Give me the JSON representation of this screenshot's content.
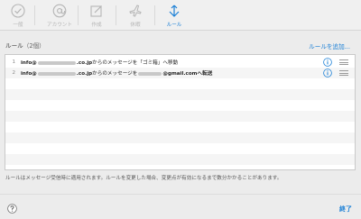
{
  "toolbar": {
    "items": [
      {
        "label": "一般",
        "icon": "check-circle-icon"
      },
      {
        "label": "アカウント",
        "icon": "at-icon"
      },
      {
        "label": "作成",
        "icon": "compose-icon"
      },
      {
        "label": "休暇",
        "icon": "airplane-icon"
      },
      {
        "label": "ルール",
        "icon": "rules-icon"
      }
    ],
    "active": "ルール"
  },
  "rules": {
    "title": "ルール",
    "count": "（2個）",
    "add_link": "ルールを追加...",
    "items": [
      {
        "num": "1",
        "prefix": "info@",
        "domain": ".co.jp",
        "text": "からのメッセージを「ゴミ箱」へ移動"
      },
      {
        "num": "2",
        "prefix": "info@",
        "domain": ".co.jp",
        "text": "からのメッセージを",
        "suffix": "@gmail.comへ転送"
      }
    ]
  },
  "note": "ルールはメッセージ受信時に適用されます。ルールを変更した場合、変更点が有効になるまで数分かかることがあります。",
  "footer": {
    "done_label": "終了"
  },
  "colors": {
    "accent": "#1a7fd6",
    "disabled": "#b5b5b5"
  }
}
